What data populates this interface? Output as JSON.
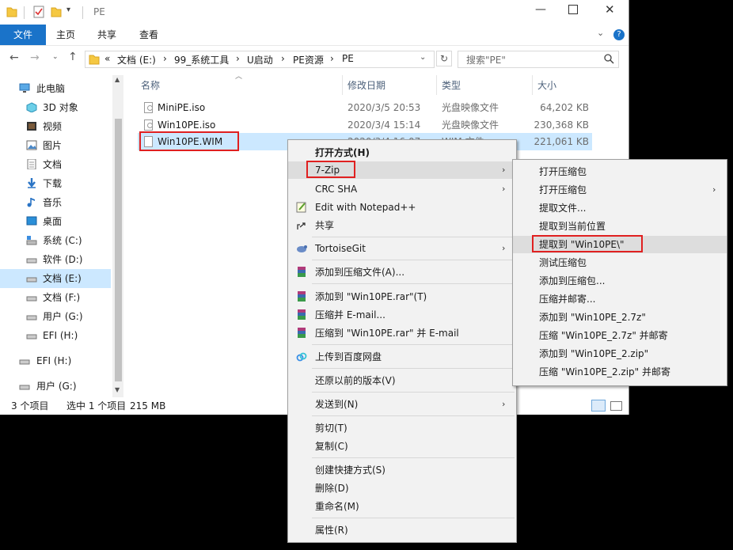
{
  "window": {
    "title": "PE",
    "ribbon_tabs": [
      "文件",
      "主页",
      "共享",
      "查看"
    ],
    "help_icon": "help-icon"
  },
  "address": {
    "crumbs": [
      "«",
      "文档 (E:)",
      "›",
      "99_系统工具",
      "›",
      "U启动",
      "›",
      "PE资源",
      "›",
      "PE"
    ],
    "search_placeholder": "搜索\"PE\""
  },
  "nav": {
    "items": [
      {
        "label": "此电脑",
        "icon": "computer-icon"
      },
      {
        "label": "3D 对象",
        "icon": "3d-objects-icon"
      },
      {
        "label": "视频",
        "icon": "video-icon"
      },
      {
        "label": "图片",
        "icon": "pictures-icon"
      },
      {
        "label": "文档",
        "icon": "documents-icon"
      },
      {
        "label": "下载",
        "icon": "download-icon"
      },
      {
        "label": "音乐",
        "icon": "music-icon"
      },
      {
        "label": "桌面",
        "icon": "desktop-icon"
      },
      {
        "label": "系统 (C:)",
        "icon": "drive-icon"
      },
      {
        "label": "软件 (D:)",
        "icon": "drive-icon"
      },
      {
        "label": "文档 (E:)",
        "icon": "drive-icon"
      },
      {
        "label": "文档 (F:)",
        "icon": "drive-icon"
      },
      {
        "label": "用户 (G:)",
        "icon": "drive-icon"
      },
      {
        "label": "EFI (H:)",
        "icon": "drive-icon"
      },
      {
        "label": "EFI (H:)",
        "icon": "drive-icon"
      },
      {
        "label": "用户 (G:)",
        "icon": "drive-icon"
      }
    ]
  },
  "columns": {
    "name": "名称",
    "date": "修改日期",
    "type": "类型",
    "size": "大小"
  },
  "files": [
    {
      "name": "MiniPE.iso",
      "date": "2020/3/5 20:53",
      "type": "光盘映像文件",
      "size": "64,202 KB"
    },
    {
      "name": "Win10PE.iso",
      "date": "2020/3/4 15:14",
      "type": "光盘映像文件",
      "size": "230,368 KB"
    },
    {
      "name": "Win10PE.WIM",
      "date": "2020/3/4 16:07",
      "type": "WIM 文件",
      "size": "221,061 KB"
    }
  ],
  "status": {
    "count": "3 个项目",
    "selected": "选中 1 个项目",
    "size": "215 MB"
  },
  "context_menu": {
    "items": [
      "打开方式(H)",
      "7-Zip",
      "CRC SHA",
      "Edit with Notepad++",
      "共享",
      "TortoiseGit",
      "添加到压缩文件(A)...",
      "添加到 \"Win10PE.rar\"(T)",
      "压缩并 E-mail...",
      "压缩到 \"Win10PE.rar\" 并 E-mail",
      "上传到百度网盘",
      "还原以前的版本(V)",
      "发送到(N)",
      "剪切(T)",
      "复制(C)",
      "创建快捷方式(S)",
      "删除(D)",
      "重命名(M)",
      "属性(R)"
    ]
  },
  "submenu": {
    "items": [
      "打开压缩包",
      "打开压缩包",
      "提取文件...",
      "提取到当前位置",
      "提取到 \"Win10PE\\\"",
      "测试压缩包",
      "添加到压缩包...",
      "压缩并邮寄...",
      "添加到 \"Win10PE_2.7z\"",
      "压缩 \"Win10PE_2.7z\" 并邮寄",
      "添加到 \"Win10PE_2.zip\"",
      "压缩 \"Win10PE_2.zip\" 并邮寄"
    ]
  },
  "colors": {
    "accent": "#1a73c9",
    "selection": "#cce8ff",
    "highlight_box": "#e02020"
  }
}
